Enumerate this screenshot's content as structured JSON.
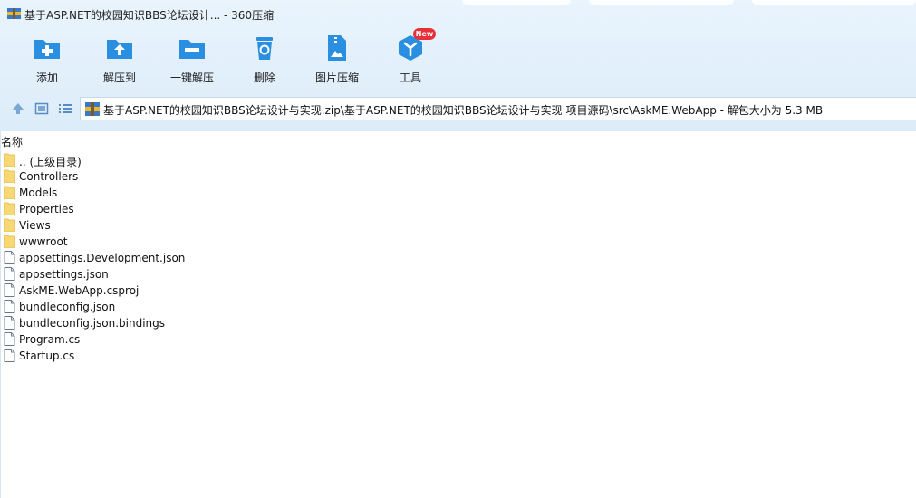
{
  "window": {
    "title": "基于ASP.NET的校园知识BBS论坛设计... - 360压缩"
  },
  "toolbar": {
    "buttons": [
      {
        "label": "添加",
        "icon": "add-folder-icon"
      },
      {
        "label": "解压到",
        "icon": "extract-to-icon"
      },
      {
        "label": "一键解压",
        "icon": "one-click-extract-icon"
      },
      {
        "label": "删除",
        "icon": "delete-icon"
      },
      {
        "label": "图片压缩",
        "icon": "image-compress-icon"
      },
      {
        "label": "工具",
        "icon": "tools-icon"
      }
    ],
    "new_badge": "New"
  },
  "addressbar": {
    "path": "基于ASP.NET的校园知识BBS论坛设计与实现.zip\\基于ASP.NET的校园知识BBS论坛设计与实现 项目源码\\src\\AskME.WebApp - 解包大小为 5.3 MB"
  },
  "list": {
    "column_name": "名称",
    "items": [
      {
        "name": ".. (上级目录)",
        "type": "folder"
      },
      {
        "name": "Controllers",
        "type": "folder"
      },
      {
        "name": "Models",
        "type": "folder"
      },
      {
        "name": "Properties",
        "type": "folder"
      },
      {
        "name": "Views",
        "type": "folder"
      },
      {
        "name": "wwwroot",
        "type": "folder"
      },
      {
        "name": "appsettings.Development.json",
        "type": "file"
      },
      {
        "name": "appsettings.json",
        "type": "file"
      },
      {
        "name": "AskME.WebApp.csproj",
        "type": "file"
      },
      {
        "name": "bundleconfig.json",
        "type": "file"
      },
      {
        "name": "bundleconfig.json.bindings",
        "type": "file"
      },
      {
        "name": "Program.cs",
        "type": "file"
      },
      {
        "name": "Startup.cs",
        "type": "file"
      }
    ]
  },
  "colors": {
    "accent_blue": "#2a8fe0",
    "folder_yellow": "#f8d775",
    "badge_red": "#e8303a"
  }
}
